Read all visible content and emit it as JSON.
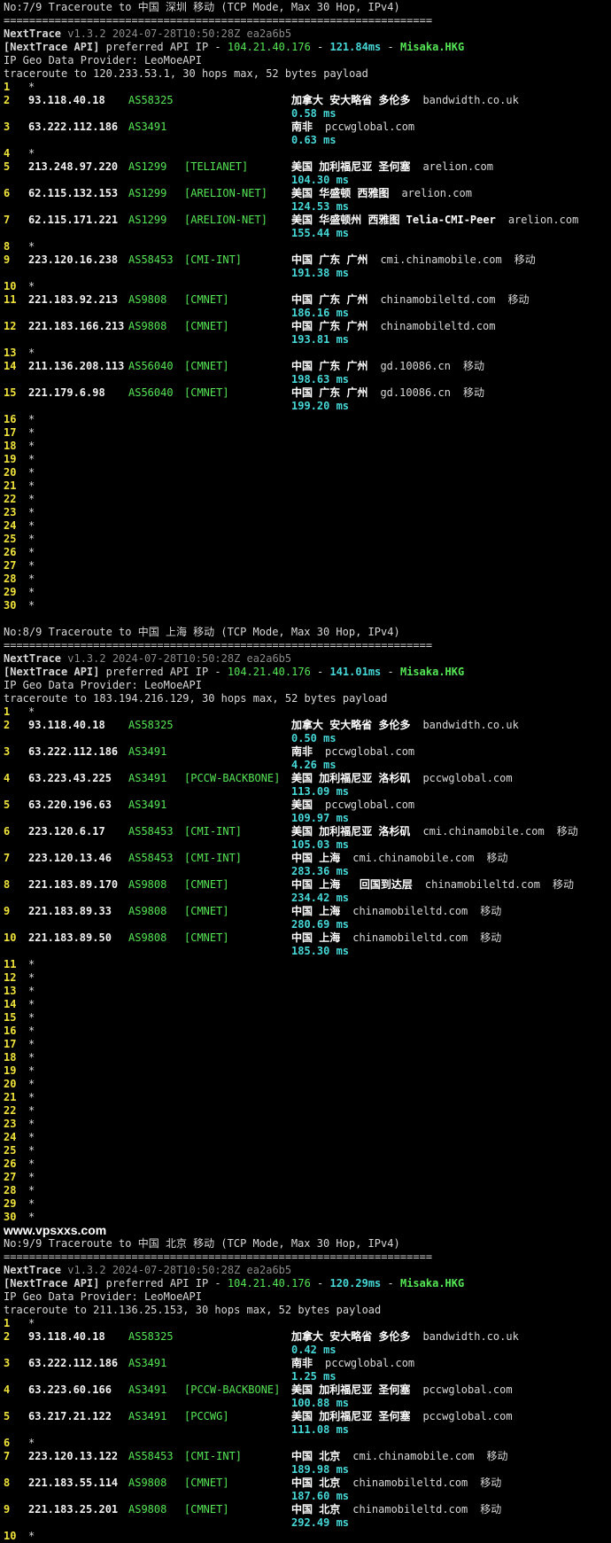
{
  "watermark": "www.vpsxxs.com",
  "sections": [
    {
      "header": "No:7/9 Traceroute to 中国 深圳 移动 (TCP Mode, Max 30 Hop, IPv4)",
      "separator": "===================================================================",
      "version_name": "NextTrace",
      "version_info": " v1.3.2 2024-07-28T10:50:28Z ea2a6b5",
      "api_prefix": "[NextTrace API]",
      "api_mid": " preferred API IP - ",
      "api_ip": "104.21.40.176",
      "api_dash1": " - ",
      "api_ms": "121.84ms",
      "api_dash2": " - ",
      "api_node": "Misaka.HKG",
      "geo_provider": "IP Geo Data Provider: LeoMoeAPI",
      "traceroute_line": "traceroute to 120.233.53.1, 30 hops max, 52 bytes payload",
      "hops": [
        {
          "n": "1",
          "star": "*"
        },
        {
          "n": "2",
          "ip": "93.118.40.18",
          "as": "AS58325",
          "tag": "",
          "geo": "加拿大 安大略省 多伦多",
          "domain": "bandwidth.co.uk",
          "isp": "",
          "ms": "0.58 ms"
        },
        {
          "n": "3",
          "ip": "63.222.112.186",
          "as": "AS3491",
          "tag": "",
          "geo": "南非",
          "domain": "pccwglobal.com",
          "isp": "",
          "ms": "0.63 ms"
        },
        {
          "n": "4",
          "star": "*"
        },
        {
          "n": "5",
          "ip": "213.248.97.220",
          "as": "AS1299",
          "tag": "[TELIANET]",
          "geo": "美国 加利福尼亚 圣何塞",
          "domain": "arelion.com",
          "isp": "",
          "ms": "104.30 ms"
        },
        {
          "n": "6",
          "ip": "62.115.132.153",
          "as": "AS1299",
          "tag": "[ARELION-NET]",
          "geo": "美国 华盛顿 西雅图",
          "domain": "arelion.com",
          "isp": "",
          "ms": "124.53 ms"
        },
        {
          "n": "7",
          "ip": "62.115.171.221",
          "as": "AS1299",
          "tag": "[ARELION-NET]",
          "geo": "美国 华盛顿州 西雅图 Telia-CMI-Peer",
          "domain": "arelion.com",
          "isp": "",
          "ms": "155.44 ms"
        },
        {
          "n": "8",
          "star": "*"
        },
        {
          "n": "9",
          "ip": "223.120.16.238",
          "as": "AS58453",
          "tag": "[CMI-INT]",
          "geo": "中国 广东 广州",
          "domain": "cmi.chinamobile.com",
          "isp": "移动",
          "ms": "191.38 ms"
        },
        {
          "n": "10",
          "star": "*"
        },
        {
          "n": "11",
          "ip": "221.183.92.213",
          "as": "AS9808",
          "tag": "[CMNET]",
          "geo": "中国 广东 广州",
          "domain": "chinamobileltd.com",
          "isp": "移动",
          "ms": "186.16 ms"
        },
        {
          "n": "12",
          "ip": "221.183.166.213",
          "as": "AS9808",
          "tag": "[CMNET]",
          "geo": "中国 广东 广州",
          "domain": "chinamobileltd.com",
          "isp": "",
          "ms": "193.81 ms"
        },
        {
          "n": "13",
          "star": "*"
        },
        {
          "n": "14",
          "ip": "211.136.208.113",
          "as": "AS56040",
          "tag": "[CMNET]",
          "geo": "中国 广东 广州",
          "domain": "gd.10086.cn",
          "isp": "移动",
          "ms": "198.63 ms"
        },
        {
          "n": "15",
          "ip": "221.179.6.98",
          "as": "AS56040",
          "tag": "[CMNET]",
          "geo": "中国 广东 广州",
          "domain": "gd.10086.cn",
          "isp": "移动",
          "ms": "199.20 ms"
        },
        {
          "n": "16",
          "star": "*"
        },
        {
          "n": "17",
          "star": "*"
        },
        {
          "n": "18",
          "star": "*"
        },
        {
          "n": "19",
          "star": "*"
        },
        {
          "n": "20",
          "star": "*"
        },
        {
          "n": "21",
          "star": "*"
        },
        {
          "n": "22",
          "star": "*"
        },
        {
          "n": "23",
          "star": "*"
        },
        {
          "n": "24",
          "star": "*"
        },
        {
          "n": "25",
          "star": "*"
        },
        {
          "n": "26",
          "star": "*"
        },
        {
          "n": "27",
          "star": "*"
        },
        {
          "n": "28",
          "star": "*"
        },
        {
          "n": "29",
          "star": "*"
        },
        {
          "n": "30",
          "star": "*"
        }
      ]
    },
    {
      "header": "No:8/9 Traceroute to 中国 上海 移动 (TCP Mode, Max 30 Hop, IPv4)",
      "separator": "===================================================================",
      "version_name": "NextTrace",
      "version_info": " v1.3.2 2024-07-28T10:50:28Z ea2a6b5",
      "api_prefix": "[NextTrace API]",
      "api_mid": " preferred API IP - ",
      "api_ip": "104.21.40.176",
      "api_dash1": " - ",
      "api_ms": "141.01ms",
      "api_dash2": " - ",
      "api_node": "Misaka.HKG",
      "geo_provider": "IP Geo Data Provider: LeoMoeAPI",
      "traceroute_line": "traceroute to 183.194.216.129, 30 hops max, 52 bytes payload",
      "hops": [
        {
          "n": "1",
          "star": "*"
        },
        {
          "n": "2",
          "ip": "93.118.40.18",
          "as": "AS58325",
          "tag": "",
          "geo": "加拿大 安大略省 多伦多",
          "domain": "bandwidth.co.uk",
          "isp": "",
          "ms": "0.50 ms"
        },
        {
          "n": "3",
          "ip": "63.222.112.186",
          "as": "AS3491",
          "tag": "",
          "geo": "南非",
          "domain": "pccwglobal.com",
          "isp": "",
          "ms": "4.26 ms"
        },
        {
          "n": "4",
          "ip": "63.223.43.225",
          "as": "AS3491",
          "tag": "[PCCW-BACKBONE]",
          "geo": "美国 加利福尼亚 洛杉矶",
          "domain": "pccwglobal.com",
          "isp": "",
          "ms": "113.09 ms"
        },
        {
          "n": "5",
          "ip": "63.220.196.63",
          "as": "AS3491",
          "tag": "",
          "geo": "美国",
          "domain": "pccwglobal.com",
          "isp": "",
          "ms": "109.97 ms"
        },
        {
          "n": "6",
          "ip": "223.120.6.17",
          "as": "AS58453",
          "tag": "[CMI-INT]",
          "geo": "美国 加利福尼亚 洛杉矶",
          "domain": "cmi.chinamobile.com",
          "isp": "移动",
          "ms": "105.03 ms"
        },
        {
          "n": "7",
          "ip": "223.120.13.46",
          "as": "AS58453",
          "tag": "[CMI-INT]",
          "geo": "中国 上海",
          "domain": "cmi.chinamobile.com",
          "isp": "移动",
          "ms": "283.36 ms"
        },
        {
          "n": "8",
          "ip": "221.183.89.170",
          "as": "AS9808",
          "tag": "[CMNET]",
          "geo": "中国 上海   回国到达层",
          "domain": "chinamobileltd.com",
          "isp": "移动",
          "ms": "234.42 ms"
        },
        {
          "n": "9",
          "ip": "221.183.89.33",
          "as": "AS9808",
          "tag": "[CMNET]",
          "geo": "中国 上海",
          "domain": "chinamobileltd.com",
          "isp": "移动",
          "ms": "280.69 ms"
        },
        {
          "n": "10",
          "ip": "221.183.89.50",
          "as": "AS9808",
          "tag": "[CMNET]",
          "geo": "中国 上海",
          "domain": "chinamobileltd.com",
          "isp": "移动",
          "ms": "185.30 ms"
        },
        {
          "n": "11",
          "star": "*"
        },
        {
          "n": "12",
          "star": "*"
        },
        {
          "n": "13",
          "star": "*"
        },
        {
          "n": "14",
          "star": "*"
        },
        {
          "n": "15",
          "star": "*"
        },
        {
          "n": "16",
          "star": "*"
        },
        {
          "n": "17",
          "star": "*"
        },
        {
          "n": "18",
          "star": "*"
        },
        {
          "n": "19",
          "star": "*"
        },
        {
          "n": "20",
          "star": "*"
        },
        {
          "n": "21",
          "star": "*"
        },
        {
          "n": "22",
          "star": "*"
        },
        {
          "n": "23",
          "star": "*"
        },
        {
          "n": "24",
          "star": "*"
        },
        {
          "n": "25",
          "star": "*"
        },
        {
          "n": "26",
          "star": "*"
        },
        {
          "n": "27",
          "star": "*"
        },
        {
          "n": "28",
          "star": "*"
        },
        {
          "n": "29",
          "star": "*"
        },
        {
          "n": "30",
          "star": "*"
        }
      ]
    },
    {
      "header": "No:9/9 Traceroute to 中国 北京 移动 (TCP Mode, Max 30 Hop, IPv4)",
      "separator": "===================================================================",
      "version_name": "NextTrace",
      "version_info": " v1.3.2 2024-07-28T10:50:28Z ea2a6b5",
      "api_prefix": "[NextTrace API]",
      "api_mid": " preferred API IP - ",
      "api_ip": "104.21.40.176",
      "api_dash1": " - ",
      "api_ms": "120.29ms",
      "api_dash2": " - ",
      "api_node": "Misaka.HKG",
      "geo_provider": "IP Geo Data Provider: LeoMoeAPI",
      "traceroute_line": "traceroute to 211.136.25.153, 30 hops max, 52 bytes payload",
      "hops": [
        {
          "n": "1",
          "star": "*"
        },
        {
          "n": "2",
          "ip": "93.118.40.18",
          "as": "AS58325",
          "tag": "",
          "geo": "加拿大 安大略省 多伦多",
          "domain": "bandwidth.co.uk",
          "isp": "",
          "ms": "0.42 ms"
        },
        {
          "n": "3",
          "ip": "63.222.112.186",
          "as": "AS3491",
          "tag": "",
          "geo": "南非",
          "domain": "pccwglobal.com",
          "isp": "",
          "ms": "1.25 ms"
        },
        {
          "n": "4",
          "ip": "63.223.60.166",
          "as": "AS3491",
          "tag": "[PCCW-BACKBONE]",
          "geo": "美国 加利福尼亚 圣何塞",
          "domain": "pccwglobal.com",
          "isp": "",
          "ms": "100.88 ms"
        },
        {
          "n": "5",
          "ip": "63.217.21.122",
          "as": "AS3491",
          "tag": "[PCCWG]",
          "geo": "美国 加利福尼亚 圣何塞",
          "domain": "pccwglobal.com",
          "isp": "",
          "ms": "111.08 ms"
        },
        {
          "n": "6",
          "star": "*"
        },
        {
          "n": "7",
          "ip": "223.120.13.122",
          "as": "AS58453",
          "tag": "[CMI-INT]",
          "geo": "中国 北京",
          "domain": "cmi.chinamobile.com",
          "isp": "移动",
          "ms": "189.98 ms"
        },
        {
          "n": "8",
          "ip": "221.183.55.114",
          "as": "AS9808",
          "tag": "[CMNET]",
          "geo": "中国 北京",
          "domain": "chinamobileltd.com",
          "isp": "移动",
          "ms": "187.60 ms"
        },
        {
          "n": "9",
          "ip": "221.183.25.201",
          "as": "AS9808",
          "tag": "[CMNET]",
          "geo": "中国 北京",
          "domain": "chinamobileltd.com",
          "isp": "移动",
          "ms": "292.49 ms"
        },
        {
          "n": "10",
          "star": "*"
        }
      ]
    }
  ]
}
